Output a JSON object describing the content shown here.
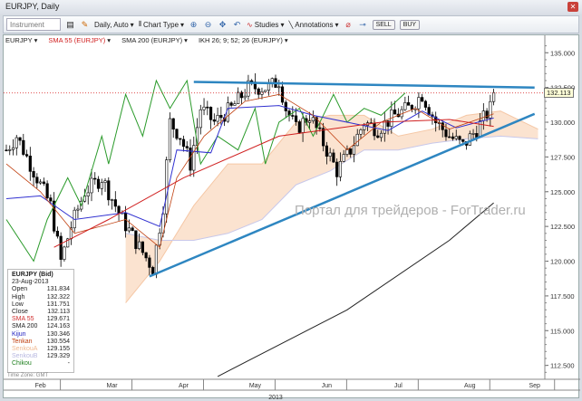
{
  "window": {
    "title": "EURJPY, Daily",
    "close_icon": "close-icon"
  },
  "toolbar": {
    "instrument_placeholder": "Instrument",
    "period": "Daily, Auto",
    "chart_type": "Chart Type",
    "studies": "Studies",
    "annotations": "Annotations",
    "sell": "SELL",
    "buy": "BUY"
  },
  "indicators": [
    {
      "label": "EURJPY",
      "color": "#222"
    },
    {
      "label": "SMA 55 (EURJPY)",
      "color": "#d02020"
    },
    {
      "label": "SMA 200 (EURJPY)",
      "color": "#222"
    },
    {
      "label": "IKH 26; 9; 52; 26 (EURJPY)",
      "color": "#222"
    }
  ],
  "info": {
    "title": "EURJPY (Bid)",
    "date": "23-Aug-2013",
    "rows": [
      {
        "k": "Open",
        "v": "131.834",
        "c": "#222"
      },
      {
        "k": "High",
        "v": "132.322",
        "c": "#222"
      },
      {
        "k": "Low",
        "v": "131.751",
        "c": "#222"
      },
      {
        "k": "Close",
        "v": "132.113",
        "c": "#222"
      },
      {
        "k": "SMA 55",
        "v": "129.671",
        "c": "#d03030"
      },
      {
        "k": "SMA 200",
        "v": "124.163",
        "c": "#222"
      },
      {
        "k": "Kijun",
        "v": "130.346",
        "c": "#2020c0"
      },
      {
        "k": "Tenkan",
        "v": "130.554",
        "c": "#c04010"
      },
      {
        "k": "SenkouA",
        "v": "129.155",
        "c": "#f0b890"
      },
      {
        "k": "SenkouB",
        "v": "129.329",
        "c": "#b8b8e0"
      },
      {
        "k": "Chikou",
        "v": "-",
        "c": "#208020"
      }
    ]
  },
  "timezone": "Time Zone: GMT",
  "watermark": "Портал для трейдеров - ForTrader.ru",
  "current_price": "132.113",
  "chart_data": {
    "type": "candlestick",
    "symbol": "EURJPY",
    "timeframe": "Daily",
    "ylim": [
      111.5,
      135.8
    ],
    "yticks": [
      "135.000",
      "132.500",
      "130.000",
      "127.500",
      "125.000",
      "122.500",
      "120.000",
      "117.500",
      "115.000",
      "112.500"
    ],
    "ytick_values": [
      135,
      132.5,
      130,
      127.5,
      125,
      122.5,
      120,
      117.5,
      115,
      112.5
    ],
    "xticks": [
      "Feb",
      "Mar",
      "Apr",
      "May",
      "Jun",
      "Jul",
      "Aug",
      "Sep"
    ],
    "xtick_days": [
      10,
      31,
      52,
      73,
      94,
      115,
      136,
      155
    ],
    "year_label": "2013",
    "day_range": [
      0,
      158
    ],
    "close_path": [
      [
        0,
        128
      ],
      [
        3,
        129
      ],
      [
        9,
        126
      ],
      [
        13,
        124
      ],
      [
        16,
        120
      ],
      [
        19,
        122.5
      ],
      [
        23,
        125
      ],
      [
        28,
        126
      ],
      [
        34,
        123
      ],
      [
        39,
        121
      ],
      [
        43,
        119.5
      ],
      [
        46,
        124
      ],
      [
        48,
        130
      ],
      [
        51,
        129
      ],
      [
        54,
        127
      ],
      [
        57,
        131
      ],
      [
        61,
        130
      ],
      [
        66,
        131
      ],
      [
        71,
        132.5
      ],
      [
        77,
        132.5
      ],
      [
        80,
        133
      ],
      [
        82,
        131
      ],
      [
        85,
        129.5
      ],
      [
        89,
        130.5
      ],
      [
        93,
        128.5
      ],
      [
        97,
        126.5
      ],
      [
        101,
        128
      ],
      [
        105,
        130
      ],
      [
        109,
        129.5
      ],
      [
        114,
        130.5
      ],
      [
        118,
        131
      ],
      [
        122,
        132
      ],
      [
        126,
        130
      ],
      [
        130,
        129
      ],
      [
        134,
        128.3
      ],
      [
        138,
        129.5
      ],
      [
        142,
        131
      ],
      [
        143,
        132.1
      ]
    ],
    "sma55": [
      [
        14,
        121
      ],
      [
        30,
        123
      ],
      [
        52,
        126
      ],
      [
        80,
        129
      ],
      [
        110,
        130
      ],
      [
        130,
        130.2
      ],
      [
        143,
        129.7
      ]
    ],
    "sma200": [
      [
        62,
        111.7
      ],
      [
        100,
        116.5
      ],
      [
        130,
        121.5
      ],
      [
        143,
        124.2
      ]
    ],
    "kijun": [
      [
        0,
        124.5
      ],
      [
        10,
        124.7
      ],
      [
        20,
        123
      ],
      [
        35,
        123.5
      ],
      [
        45,
        122.5
      ],
      [
        50,
        128
      ],
      [
        60,
        127.8
      ],
      [
        65,
        131
      ],
      [
        80,
        131.2
      ],
      [
        90,
        130.5
      ],
      [
        100,
        130
      ],
      [
        112,
        129.4
      ],
      [
        122,
        130.8
      ],
      [
        132,
        129.6
      ],
      [
        143,
        130.3
      ]
    ],
    "tenkan": [
      [
        0,
        127
      ],
      [
        10,
        125
      ],
      [
        20,
        122
      ],
      [
        35,
        123
      ],
      [
        45,
        121
      ],
      [
        50,
        126
      ],
      [
        58,
        129
      ],
      [
        70,
        131.5
      ],
      [
        80,
        132
      ],
      [
        90,
        130.5
      ],
      [
        100,
        128
      ],
      [
        110,
        130
      ],
      [
        120,
        131
      ],
      [
        130,
        129.5
      ],
      [
        143,
        130.6
      ]
    ],
    "chikou": [
      [
        0,
        123
      ],
      [
        8,
        120
      ],
      [
        12,
        123
      ],
      [
        18,
        126
      ],
      [
        22,
        124
      ],
      [
        28,
        129
      ],
      [
        30,
        127
      ],
      [
        35,
        132
      ],
      [
        40,
        129
      ],
      [
        44,
        133
      ],
      [
        48,
        131
      ],
      [
        53,
        133
      ],
      [
        57,
        127
      ],
      [
        62,
        129
      ],
      [
        68,
        128
      ],
      [
        73,
        131
      ],
      [
        76,
        127
      ],
      [
        80,
        130
      ],
      [
        86,
        131
      ],
      [
        90,
        129
      ],
      [
        96,
        132
      ],
      [
        100,
        130
      ],
      [
        105,
        131
      ],
      [
        110,
        130.5
      ],
      [
        117,
        132.1
      ]
    ],
    "senkou_a": [
      [
        35,
        117
      ],
      [
        45,
        120
      ],
      [
        55,
        124
      ],
      [
        65,
        127
      ],
      [
        75,
        127
      ],
      [
        85,
        130
      ],
      [
        95,
        130.5
      ],
      [
        105,
        130.5
      ],
      [
        115,
        129
      ],
      [
        125,
        129.5
      ],
      [
        135,
        130.5
      ],
      [
        145,
        130.8
      ],
      [
        156,
        129.5
      ]
    ],
    "senkou_b": [
      [
        35,
        122
      ],
      [
        45,
        121.5
      ],
      [
        55,
        121.5
      ],
      [
        65,
        122
      ],
      [
        75,
        123
      ],
      [
        85,
        125.5
      ],
      [
        95,
        126.5
      ],
      [
        105,
        128
      ],
      [
        115,
        128
      ],
      [
        125,
        128.5
      ],
      [
        135,
        128.8
      ],
      [
        145,
        129
      ],
      [
        156,
        128.8
      ]
    ],
    "trendline_resistance": [
      [
        55,
        132.9
      ],
      [
        155,
        132.5
      ]
    ],
    "trendline_support": [
      [
        42,
        118.9
      ],
      [
        155,
        130.6
      ]
    ],
    "last_price": 132.113
  }
}
